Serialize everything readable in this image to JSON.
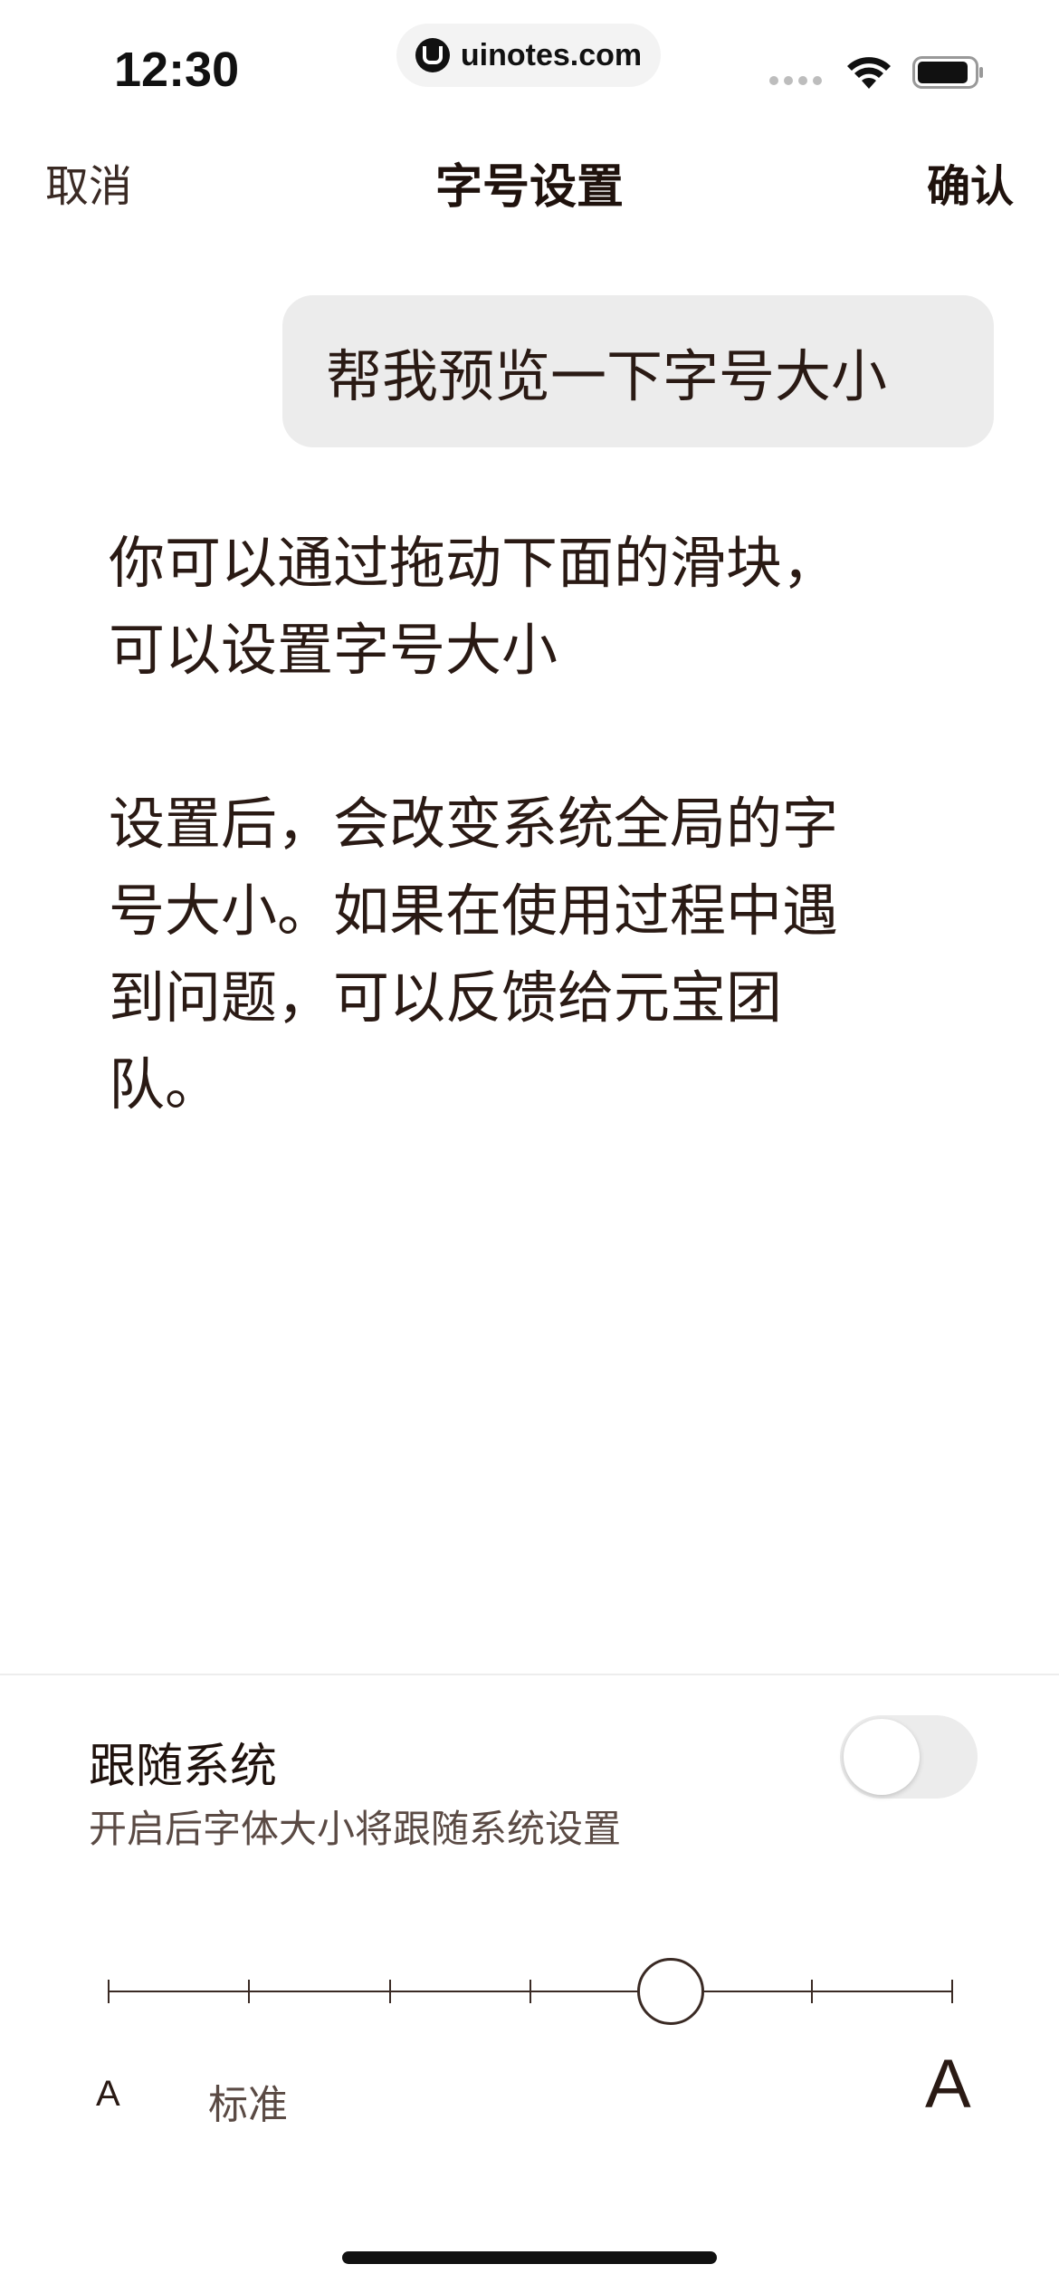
{
  "status_bar": {
    "time": "12:30",
    "url": "uinotes.com"
  },
  "nav": {
    "cancel": "取消",
    "title": "字号设置",
    "confirm": "确认"
  },
  "chat": {
    "user_message": "帮我预览一下字号大小",
    "reply_paragraph_1_line_1": "你可以通过拖动下面的滑块，",
    "reply_paragraph_1_line_2": "可以设置字号大小",
    "reply_paragraph_2_line_1": "设置后，会改变系统全局的字",
    "reply_paragraph_2_line_2": "号大小。如果在使用过程中遇",
    "reply_paragraph_2_line_3": "到问题，可以反馈给元宝团",
    "reply_paragraph_2_line_4": "队。"
  },
  "follow_system": {
    "title": "跟随系统",
    "subtitle": "开启后字体大小将跟随系统设置",
    "enabled": false
  },
  "font_slider": {
    "steps": 7,
    "selected_index": 4,
    "small_label": "A",
    "standard_label": "标准",
    "large_label": "A"
  }
}
